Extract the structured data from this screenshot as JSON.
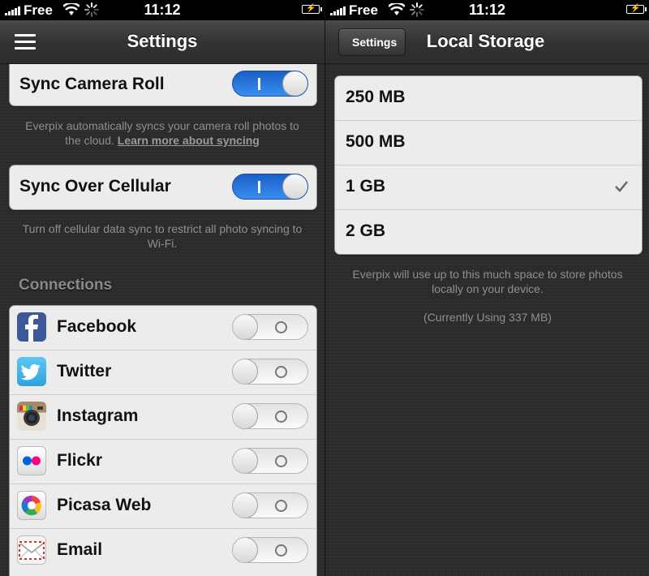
{
  "status_bar": {
    "carrier": "Free",
    "time": "11:12"
  },
  "left": {
    "nav_title": "Settings",
    "sync_camera_roll": {
      "label": "Sync Camera Roll",
      "on": true
    },
    "camera_help": "Everpix automatically syncs your camera roll photos to the cloud.",
    "camera_help_link": "Learn more about syncing",
    "sync_cellular": {
      "label": "Sync Over Cellular",
      "on": true
    },
    "cellular_help": "Turn off cellular data sync to restrict all photo syncing to Wi-Fi.",
    "connections_header": "Connections",
    "connections": [
      {
        "label": "Facebook",
        "icon": "facebook-icon",
        "on": false
      },
      {
        "label": "Twitter",
        "icon": "twitter-icon",
        "on": false
      },
      {
        "label": "Instagram",
        "icon": "instagram-icon",
        "on": false
      },
      {
        "label": "Flickr",
        "icon": "flickr-icon",
        "on": false
      },
      {
        "label": "Picasa Web",
        "icon": "picasa-icon",
        "on": false
      },
      {
        "label": "Email",
        "icon": "email-icon",
        "on": false
      }
    ]
  },
  "right": {
    "back_label": "Settings",
    "nav_title": "Local Storage",
    "options": [
      {
        "label": "250 MB",
        "selected": false
      },
      {
        "label": "500 MB",
        "selected": false
      },
      {
        "label": "1 GB",
        "selected": true
      },
      {
        "label": "2 GB",
        "selected": false
      }
    ],
    "help": "Everpix will use up to this much space to store photos locally on your device.",
    "usage": "(Currently Using 337 MB)"
  },
  "colors": {
    "toggle_on": "#2a7de0",
    "cell_bg": "#ececec",
    "background": "#2b2b2b"
  }
}
